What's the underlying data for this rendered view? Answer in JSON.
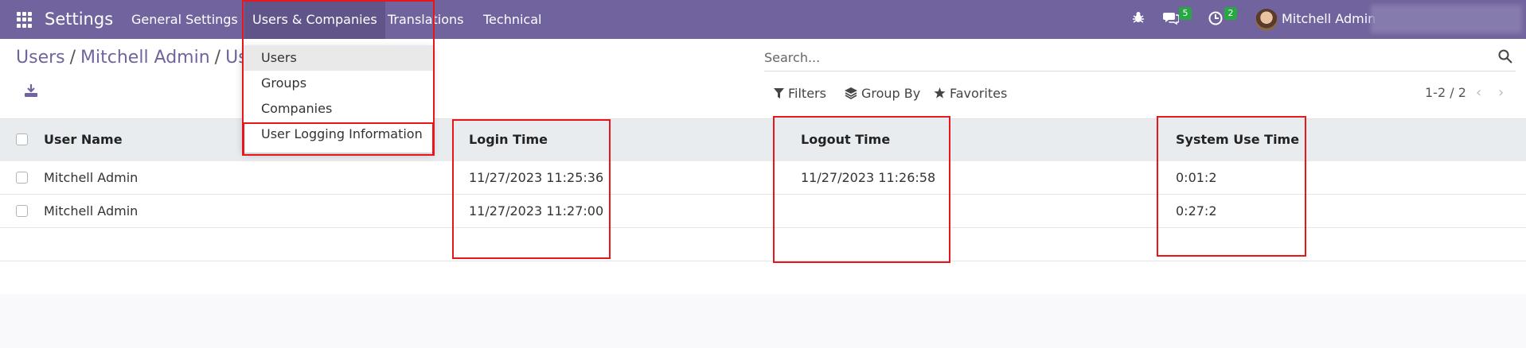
{
  "topbar": {
    "app_name": "Settings",
    "menu": [
      "General Settings",
      "Users & Companies",
      "Translations",
      "Technical"
    ],
    "chat_badge": "5",
    "activity_badge": "2",
    "user_name": "Mitchell Admin"
  },
  "dropdown": {
    "items": [
      "Users",
      "Groups",
      "Companies",
      "User Logging Information"
    ]
  },
  "breadcrumb": {
    "root": "Users",
    "record": "Mitchell Admin",
    "current": "Us"
  },
  "search": {
    "placeholder": "Search..."
  },
  "toolbar": {
    "filters": "Filters",
    "group_by": "Group By",
    "favorites": "Favorites",
    "pager": "1-2 / 2"
  },
  "table": {
    "headers": [
      "User Name",
      "Login Time",
      "Logout Time",
      "System Use Time"
    ],
    "rows": [
      {
        "user": "Mitchell Admin",
        "login": "11/27/2023 11:25:36",
        "logout": "11/27/2023 11:26:58",
        "use_time": "0:01:2"
      },
      {
        "user": "Mitchell Admin",
        "login": "11/27/2023 11:27:00",
        "logout": "",
        "use_time": "0:27:2"
      }
    ]
  },
  "colors": {
    "brand": "#71639e",
    "highlight": "#e8161b",
    "badge": "#28a745"
  }
}
